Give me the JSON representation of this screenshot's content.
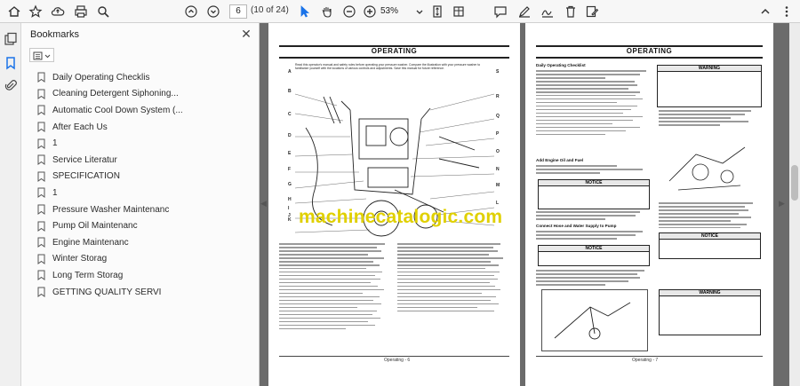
{
  "toolbar": {
    "page_value": "6",
    "page_count": "(10 of 24)",
    "zoom": "53%"
  },
  "bookmarks": {
    "title": "Bookmarks",
    "items": [
      {
        "label": "Daily Operating Checklis"
      },
      {
        "label": "Cleaning Detergent Siphoning..."
      },
      {
        "label": "Automatic Cool Down System (..."
      },
      {
        "label": "After Each Us"
      },
      {
        "label": "1"
      },
      {
        "label": "Service Literatur"
      },
      {
        "label": "SPECIFICATION"
      },
      {
        "label": "1"
      },
      {
        "label": "Pressure Washer Maintenanc"
      },
      {
        "label": "Pump Oil Maintenanc"
      },
      {
        "label": "Engine Maintenanc"
      },
      {
        "label": "Winter Storag"
      },
      {
        "label": "Long Term Storag"
      },
      {
        "label": "GETTING QUALITY SERVI"
      }
    ]
  },
  "left_page": {
    "title": "OPERATING",
    "intro": "Read this operator's manual and safety rules before operating your pressure washer. Compare the illustration with your pressure washer to familiarize yourself with the locations of various controls and adjustments. Save this manual for future reference.",
    "callouts_left": [
      "A",
      "B",
      "C",
      "D",
      "E",
      "F",
      "G",
      "H",
      "I",
      "J",
      "K"
    ],
    "callouts_right": [
      "S",
      "R",
      "Q",
      "P",
      "O",
      "N",
      "M",
      "L"
    ],
    "footer": "Operating - 6"
  },
  "right_page": {
    "title": "OPERATING",
    "checklist_heading": "Daily Operating Checklist",
    "engine_heading": "Add Engine Oil and Fuel",
    "connect_heading": "Connect Hose and Water Supply to Pump",
    "notice_label": "NOTICE",
    "warning_label": "WARNING",
    "footer": "Operating - 7"
  },
  "watermark": "machinecatalogic.com"
}
